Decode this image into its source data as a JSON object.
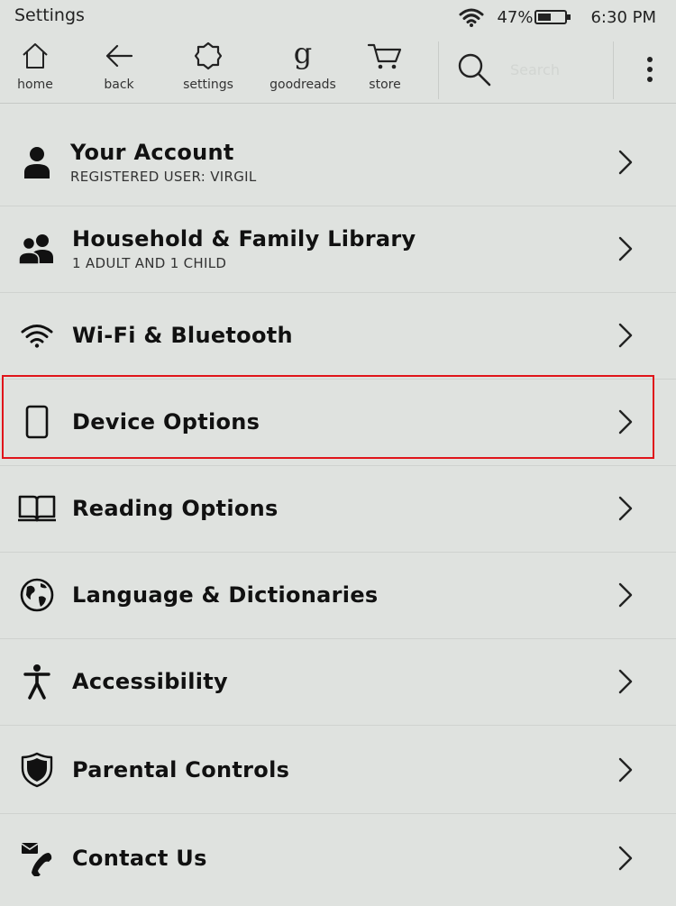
{
  "status": {
    "title": "Settings",
    "battery": "47%",
    "battery_level": 0.47,
    "time": "6:30 PM"
  },
  "toolbar": {
    "home_label": "home",
    "back_label": "back",
    "settings_label": "settings",
    "goodreads_label": "goodreads",
    "goodreads_glyph": "g",
    "store_label": "store",
    "search_placeholder": "Search"
  },
  "settings": {
    "items": [
      {
        "title": "Your Account",
        "subtitle": "REGISTERED USER: VIRGIL",
        "icon": "person-icon"
      },
      {
        "title": "Household & Family Library",
        "subtitle": "1 ADULT AND 1 CHILD",
        "icon": "people-icon"
      },
      {
        "title": "Wi-Fi & Bluetooth",
        "subtitle": "",
        "icon": "wifi-icon"
      },
      {
        "title": "Device Options",
        "subtitle": "",
        "icon": "device-icon"
      },
      {
        "title": "Reading Options",
        "subtitle": "",
        "icon": "book-icon"
      },
      {
        "title": "Language & Dictionaries",
        "subtitle": "",
        "icon": "globe-icon"
      },
      {
        "title": "Accessibility",
        "subtitle": "",
        "icon": "accessibility-icon"
      },
      {
        "title": "Parental Controls",
        "subtitle": "",
        "icon": "shield-icon"
      },
      {
        "title": "Contact Us",
        "subtitle": "",
        "icon": "contact-icon"
      }
    ]
  },
  "colors": {
    "background": "#dfe2df",
    "highlight": "#e0141a"
  }
}
